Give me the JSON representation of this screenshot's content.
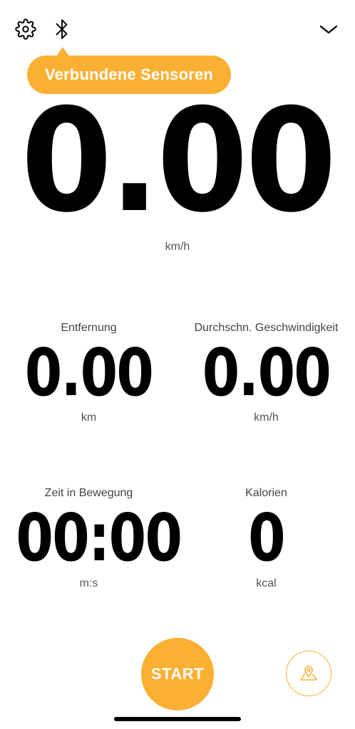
{
  "header": {
    "settings_icon": "gear-icon",
    "bluetooth_icon": "bluetooth-icon",
    "collapse_icon": "chevron-down-icon"
  },
  "tooltip": {
    "text": "Verbundene Sensoren"
  },
  "speed": {
    "value": "0.00",
    "unit": "km/h"
  },
  "stats": {
    "distance": {
      "label": "Entfernung",
      "value": "0.00",
      "unit": "km"
    },
    "avg_speed": {
      "label": "Durchschn. Geschwindigkeit",
      "value": "0.00",
      "unit": "km/h"
    },
    "moving_time": {
      "label": "Zeit in Bewegung",
      "value": "00:00",
      "unit": "m:s"
    },
    "calories": {
      "label": "Kalorien",
      "value": "0",
      "unit": "kcal"
    }
  },
  "controls": {
    "start_label": "START",
    "map_icon": "map-pin-icon"
  },
  "colors": {
    "accent": "#FBB034",
    "text": "#000000",
    "secondary_text": "#555555",
    "background": "#FFFFFF"
  }
}
